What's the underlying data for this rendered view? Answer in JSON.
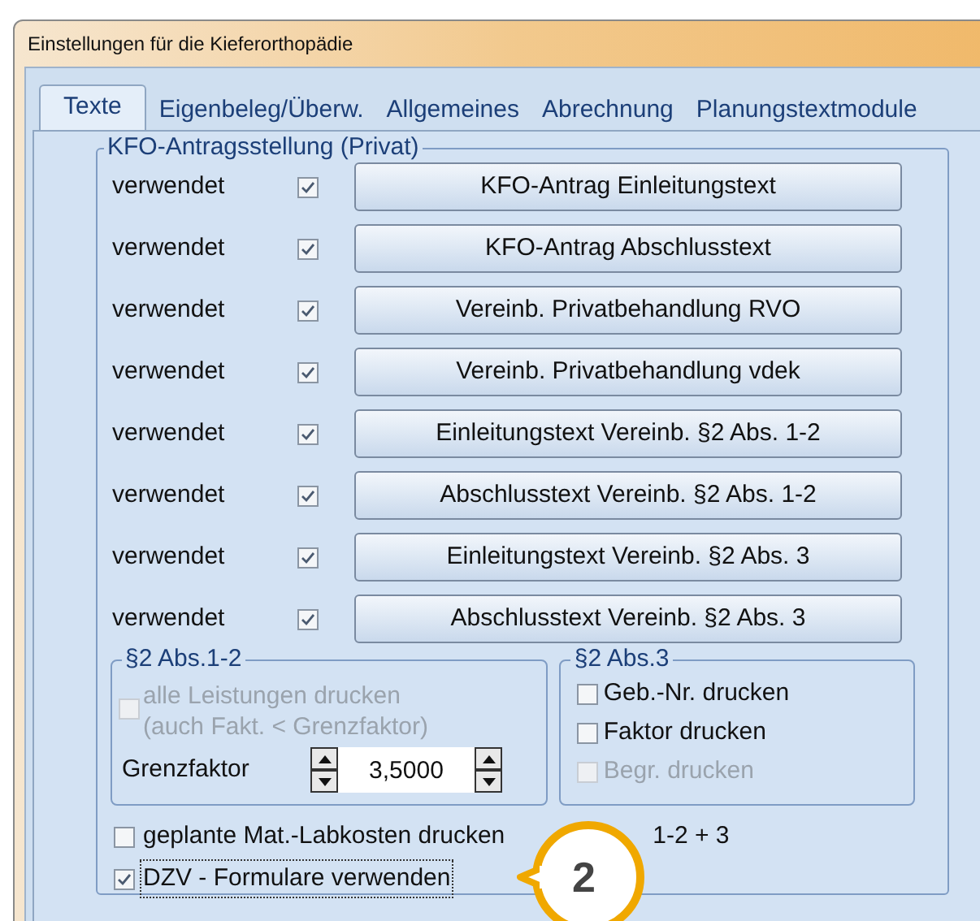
{
  "window": {
    "title": "Einstellungen für die Kieferorthopädie"
  },
  "tabs": [
    {
      "label": "Texte",
      "selected": true
    },
    {
      "label": "Eigenbeleg/Überw.",
      "selected": false
    },
    {
      "label": "Allgemeines",
      "selected": false
    },
    {
      "label": "Abrechnung",
      "selected": false
    },
    {
      "label": "Planungstextmodule",
      "selected": false
    }
  ],
  "group": {
    "title": "KFO-Antragsstellung (Privat)",
    "rows": [
      {
        "label": "verwendet",
        "checked": true,
        "button": "KFO-Antrag Einleitungstext"
      },
      {
        "label": "verwendet",
        "checked": true,
        "button": "KFO-Antrag Abschlusstext"
      },
      {
        "label": "verwendet",
        "checked": true,
        "button": "Vereinb. Privatbehandlung RVO"
      },
      {
        "label": "verwendet",
        "checked": true,
        "button": "Vereinb. Privatbehandlung vdek"
      },
      {
        "label": "verwendet",
        "checked": true,
        "button": "Einleitungstext Vereinb. §2 Abs. 1-2"
      },
      {
        "label": "verwendet",
        "checked": true,
        "button": "Abschlusstext Vereinb. §2 Abs. 1-2"
      },
      {
        "label": "verwendet",
        "checked": true,
        "button": "Einleitungstext Vereinb. §2 Abs. 3"
      },
      {
        "label": "verwendet",
        "checked": true,
        "button": "Abschlusstext Vereinb. §2 Abs. 3"
      }
    ]
  },
  "abs12": {
    "title": "§2 Abs.1-2",
    "option": {
      "label": "alle Leistungen drucken\n(auch Fakt. < Grenzfaktor)",
      "checked": false,
      "disabled": true
    },
    "grenzfaktor": {
      "label": "Grenzfaktor",
      "value": "3,5000"
    }
  },
  "abs3": {
    "title": "§2 Abs.3",
    "options": [
      {
        "label": "Geb.-Nr. drucken",
        "checked": false,
        "disabled": false
      },
      {
        "label": "Faktor drucken",
        "checked": false,
        "disabled": false
      },
      {
        "label": "Begr. drucken",
        "checked": false,
        "disabled": true
      }
    ]
  },
  "bottom_options": [
    {
      "label": "geplante Mat.-Labkosten drucken",
      "suffix": "1-2 + 3",
      "checked": false,
      "focused": false
    },
    {
      "label": "DZV - Formulare verwenden",
      "checked": true,
      "focused": true
    }
  ],
  "callout": {
    "number": "2"
  }
}
